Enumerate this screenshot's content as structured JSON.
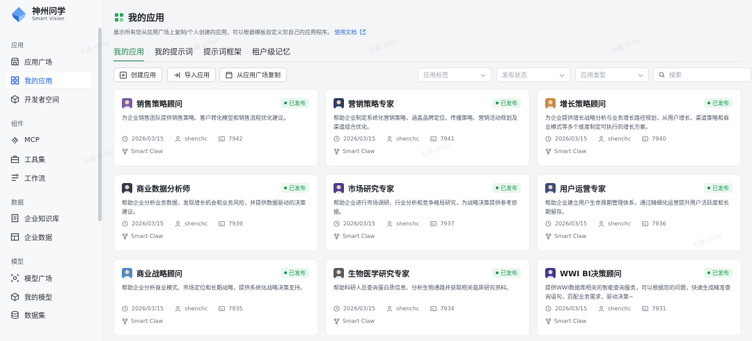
{
  "brand": {
    "name": "神州问学",
    "sub": "Smart Vision"
  },
  "sidebar": {
    "sections": [
      {
        "label": "应用",
        "items": [
          {
            "label": "应用广场",
            "icon": "store-icon"
          },
          {
            "label": "我的应用",
            "icon": "grid-icon",
            "active": true
          },
          {
            "label": "开发者空间",
            "icon": "cube-icon"
          }
        ]
      },
      {
        "label": "组件",
        "items": [
          {
            "label": "MCP",
            "icon": "mcp-icon"
          },
          {
            "label": "工具集",
            "icon": "toolbox-icon"
          },
          {
            "label": "工作流",
            "icon": "workflow-icon"
          }
        ]
      },
      {
        "label": "数据",
        "items": [
          {
            "label": "企业知识库",
            "icon": "book-icon"
          },
          {
            "label": "企业数据",
            "icon": "table-icon"
          }
        ]
      },
      {
        "label": "模型",
        "items": [
          {
            "label": "模型广场",
            "icon": "model-square-icon"
          },
          {
            "label": "我的模型",
            "icon": "model-cube-icon"
          },
          {
            "label": "数据集",
            "icon": "dataset-icon"
          }
        ]
      }
    ]
  },
  "header": {
    "title": "我的应用",
    "description": "展示所有您从应用广场上复制/个人创建的应用，可以根据模板自定义您自己的应用程序。",
    "doc_link": "使用文档"
  },
  "tabs": [
    "我的应用",
    "我的提示词",
    "提示词框架",
    "租户级记忆"
  ],
  "toolbar": {
    "create": "创建应用",
    "import": "导入应用",
    "copy": "从应用广场复制",
    "filter_tag": "应用标签",
    "filter_status": "发布状态",
    "filter_type": "应用类型",
    "search_placeholder": "搜索"
  },
  "cards": [
    {
      "title": "销售策略顾问",
      "desc": "为企业销售团队提供销售策略、客户转化模型和销售流程优化建议。",
      "date": "2026/03/15",
      "user": "shenchc",
      "id": "7942",
      "tag": "Smart Claw",
      "status": "已发布",
      "avatar_color": "#7a5ea8"
    },
    {
      "title": "营销策略专家",
      "desc": "帮助企业制定系统化营销策略，涵盖品牌定位、传播策略、营销活动规划及渠道组合优化。",
      "date": "2026/03/15",
      "user": "shenchc",
      "id": "7941",
      "tag": "Smart Claw",
      "status": "已发布",
      "avatar_color": "#2d3c66"
    },
    {
      "title": "增长策略顾问",
      "desc": "为企业提供增长战略分析与业务增长路径规划，从用户增长、渠道策略和商业模式等多个维度制定可执行的增长方案。",
      "date": "2026/03/15",
      "user": "shenchc",
      "id": "7940",
      "tag": "Smart Claw",
      "status": "已发布",
      "avatar_color": "#c98a4b"
    },
    {
      "title": "商业数据分析师",
      "desc": "帮助企业分析业务数据，发现增长机会和业务风险，并提供数据驱动的决策建议。",
      "date": "2026/03/15",
      "user": "shenchc",
      "id": "7939",
      "tag": "Smart Claw",
      "status": "已发布",
      "avatar_color": "#2f3a4a"
    },
    {
      "title": "市场研究专家",
      "desc": "帮助企业进行市场调研、行业分析和竞争格局研究，为战略决策提供参考依据。",
      "date": "2026/03/15",
      "user": "shenchc",
      "id": "7937",
      "tag": "Smart Claw",
      "status": "已发布",
      "avatar_color": "#4b3f8f"
    },
    {
      "title": "用户运营专家",
      "desc": "帮助企业建立用户生命周期管理体系，通过精细化运营提升用户活跃度和长期留存。",
      "date": "2026/03/15",
      "user": "shenchc",
      "id": "7936",
      "tag": "Smart Claw",
      "status": "已发布",
      "avatar_color": "#3a4f7a"
    },
    {
      "title": "商业战略顾问",
      "desc": "帮助企业分析商业模式、市场定位和长期战略，提供系统化战略决策支持。",
      "date": "2026/03/15",
      "user": "shenchc",
      "id": "7935",
      "tag": "Smart Claw",
      "status": "已发布",
      "avatar_color": "#4a8ac9"
    },
    {
      "title": "生物医学研究专家",
      "desc": "帮助科研人员查询蛋白质信息、分析生物通路并获取相关临床研究资料。",
      "date": "2026/03/15",
      "user": "shenchc",
      "id": "7934",
      "tag": "Smart Claw",
      "status": "已发布",
      "avatar_color": "#5a5a5a"
    },
    {
      "title": "WWI BI决策顾问",
      "desc": "提供WWI数据库相关的智能查询服务，可以根据您的问题，快速生成精准查询语句，匹配业务需求，驱动决策~",
      "date": "2026/03/15",
      "user": "shenchc",
      "id": "7931",
      "tag": "Smart Claw",
      "status": "已发布",
      "avatar_color": "#3d3b8f"
    }
  ],
  "colors": {
    "accent": "#1e8a4c",
    "link": "#2b6de0",
    "active_nav": "#1a5fd6",
    "badge_bg": "#e9f7ee",
    "badge_fg": "#1e9a55"
  }
}
